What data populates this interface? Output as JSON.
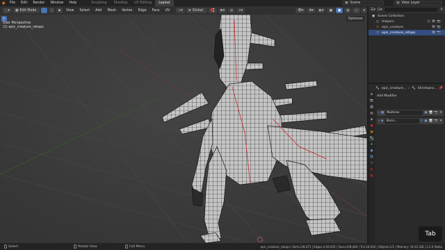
{
  "topbar": {
    "menus": [
      "File",
      "Edit",
      "Render",
      "Window",
      "Help"
    ],
    "workspaces": [
      {
        "label": "Sculpting",
        "active": false
      },
      {
        "label": "Shading",
        "active": false
      },
      {
        "label": "UV Editing",
        "active": false
      },
      {
        "label": "Layout",
        "active": true
      }
    ],
    "scene": "Scene",
    "view_layer": "View Layer"
  },
  "viewport_header": {
    "mode": "Edit Mode",
    "menus": [
      "View",
      "Select",
      "Add",
      "Mesh",
      "Vertex",
      "Edge",
      "Face",
      "UV"
    ],
    "transform_orientation": "Global",
    "options_label": "Options"
  },
  "viewport": {
    "view_name": "User Perspective",
    "object_info": "(1) epic_creature_retopo"
  },
  "outliner": {
    "rows": [
      {
        "label": "Scene Collection",
        "icon": "collection-icon",
        "indent": 0,
        "selected": false
      },
      {
        "label": "Helpers",
        "icon": "collection-icon",
        "indent": 1,
        "selected": false
      },
      {
        "label": "epic_creature",
        "icon": "mesh-icon",
        "indent": 1,
        "selected": false
      },
      {
        "label": "epic_creature_retopo",
        "icon": "mesh-icon",
        "indent": 1,
        "selected": true
      }
    ]
  },
  "properties": {
    "object_name": "epic_creature...",
    "modifier_name": "Shrinkwra...",
    "add_modifier": "Add Modifier",
    "modifiers": [
      {
        "name": "Multires"
      },
      {
        "name": "Shrin..."
      }
    ]
  },
  "statusbar": {
    "select": "Select",
    "rotate": "Rotate View",
    "call_menu": "Call Menu",
    "stats": "epic_creature_retopo | Verts:2/8,471 | Edges:1/16,935 | Faces:0/8,460 | Tris:16,920 | Objects:1/1 | Memory: 19.22 GiB | 2.2.0 Alpha"
  },
  "keycast": "Tab",
  "colors": {
    "accent": "#4772b3",
    "selection": "#e87d0d",
    "mesh": "#bdbdbd",
    "wire": "#1a1a1a",
    "seam": "#d2262a"
  }
}
